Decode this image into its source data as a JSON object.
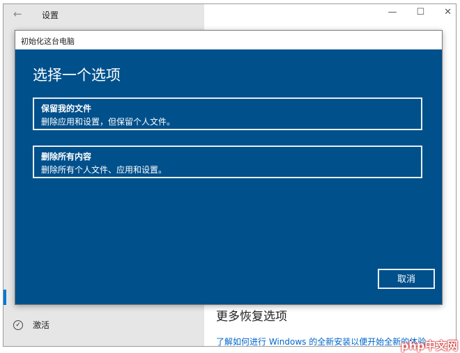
{
  "window": {
    "title": "设置",
    "back_icon": "←",
    "minimize": "—",
    "maximize": "☐",
    "close": "✕"
  },
  "sidebar": {
    "activation_label": "激活"
  },
  "main": {
    "more_heading": "更多恢复选项",
    "link": "了解如何进行 Windows 的全新安装以便开始全新的体验"
  },
  "dialog": {
    "title": "初始化这台电脑",
    "heading": "选择一个选项",
    "options": [
      {
        "title": "保留我的文件",
        "desc": "删除应用和设置，但保留个人文件。"
      },
      {
        "title": "删除所有内容",
        "desc": "删除所有个人文件、应用和设置。"
      }
    ],
    "cancel": "取消"
  },
  "watermark": "php中文网"
}
